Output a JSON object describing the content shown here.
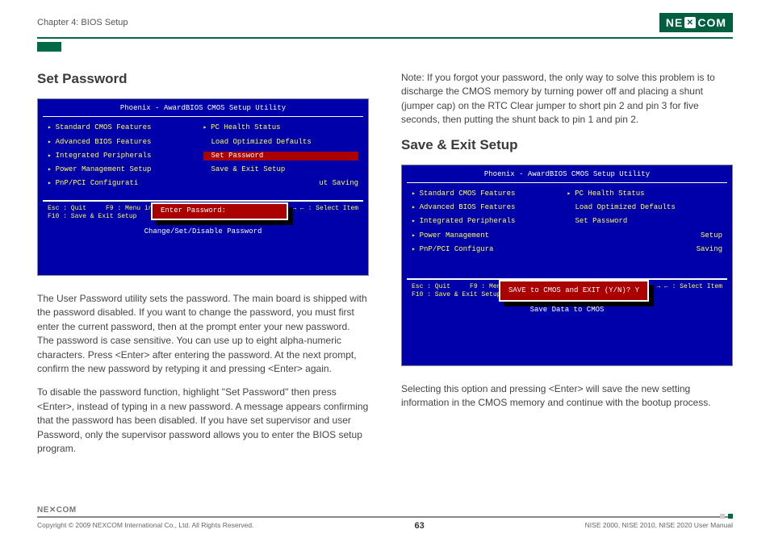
{
  "header": {
    "chapter": "Chapter 4: BIOS Setup",
    "logo_text_left": "NE",
    "logo_text_x": "✕",
    "logo_text_right": "COM"
  },
  "left": {
    "heading": "Set Password",
    "bios": {
      "title": "Phoenix - AwardBIOS CMOS Setup Utility",
      "col1": [
        "Standard CMOS Features",
        "Advanced BIOS Features",
        "Integrated Peripherals",
        "Power Management Setup",
        "PnP/PCI Configurati"
      ],
      "col2_items": [
        {
          "label": "PC Health Status",
          "arrow": true
        },
        {
          "label": "Load Optimized Defaults",
          "arrow": false
        },
        {
          "label": "Set Password",
          "arrow": false,
          "selected": true
        },
        {
          "label": "Save & Exit Setup",
          "arrow": false
        },
        {
          "label": "ut Saving",
          "arrow": false,
          "fragment": true
        }
      ],
      "dialog": "Enter Password:",
      "footer_left": "Esc : Quit     F9 : Menu in BIOS\nF10 : Save & Exit Setup",
      "footer_right": "↑ ↓ → ←   : Select Item",
      "bottom": "Change/Set/Disable Password"
    },
    "para1": "The User Password utility sets the password. The main board is shipped with the password disabled. If you want to change the password, you must first enter the current password, then at the prompt enter your new password. The password is case sensitive. You can use up to eight alpha-numeric characters. Press <Enter> after entering the password. At the next prompt, confirm the new password by retyping it and pressing <Enter> again.",
    "para2": "To disable the password function, highlight \"Set Password\" then press <Enter>, instead of typing in a new password. A message appears confirming that the password has been disabled. If you have set supervisor and user Password, only the supervisor password allows you to enter the BIOS setup program."
  },
  "right": {
    "note": "Note: If you forgot your password, the only way to solve this problem is to discharge the CMOS memory by turning power off and placing a shunt (jumper cap) on the RTC Clear jumper to short pin 2 and pin 3 for five seconds, then putting the shunt back to pin 1 and pin 2.",
    "heading": "Save & Exit Setup",
    "bios": {
      "title": "Phoenix - AwardBIOS CMOS Setup Utility",
      "col1": [
        "Standard CMOS Features",
        "Advanced BIOS Features",
        "Integrated Peripherals",
        "Power Management",
        "PnP/PCI Configura"
      ],
      "col2_items": [
        {
          "label": "PC Health Status",
          "arrow": true
        },
        {
          "label": "Load Optimized Defaults",
          "arrow": false
        },
        {
          "label": "Set Password",
          "arrow": false
        },
        {
          "label": "Setup",
          "arrow": false,
          "fragment": true
        },
        {
          "label": "Saving",
          "arrow": false,
          "fragment": true
        }
      ],
      "dialog": "SAVE to CMOS and EXIT (Y/N)? Y",
      "footer_left": "Esc : Quit     F9 : Menu in BIOS\nF10 : Save & Exit Setup",
      "footer_right": "↑ ↓ → ←   : Select Item",
      "bottom": "Save Data to CMOS"
    },
    "para1": "Selecting this option and pressing <Enter> will save the new setting information in the CMOS memory and continue with the bootup process."
  },
  "footer": {
    "logo": "NE✕COM",
    "copyright": "Copyright © 2009 NEXCOM International Co., Ltd. All Rights Reserved.",
    "page": "63",
    "manual": "NISE 2000, NISE 2010, NISE 2020 User Manual"
  }
}
